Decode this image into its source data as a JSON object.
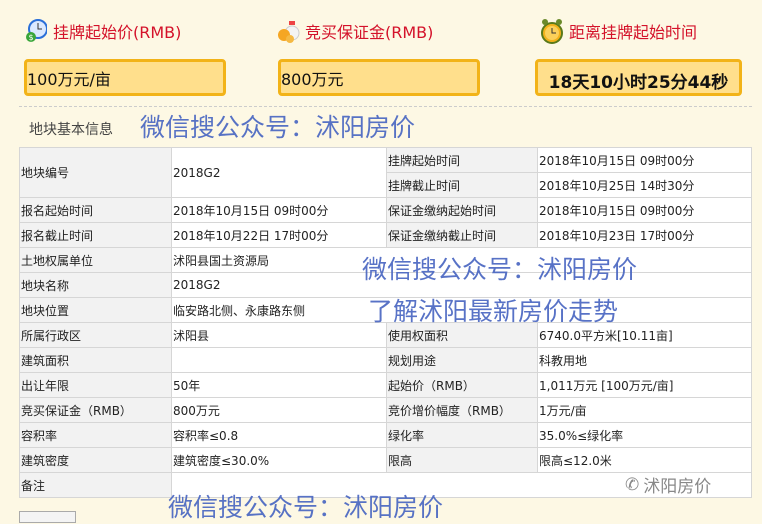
{
  "headers": [
    {
      "label": "挂牌起始价(RMB)",
      "value": "100万元/亩",
      "icon": "clock-money-icon"
    },
    {
      "label": "竞买保证金(RMB)",
      "value": "800万元",
      "icon": "money-bag-icon"
    },
    {
      "label": "距离挂牌起始时间",
      "value": "18天10小时25分44秒",
      "icon": "alarm-clock-icon"
    }
  ],
  "section_title": "地块基本信息",
  "watermarks": {
    "top": "微信搜公众号：沭阳房价",
    "mid1": "微信搜公众号：沭阳房价",
    "mid2": "了解沭阳最新房价走势",
    "bottom": "微信搜公众号：沭阳房价",
    "logo": "沭阳房价"
  },
  "table": {
    "block_no_label": "地块编号",
    "block_no": "2018G2",
    "list_start_label": "挂牌起始时间",
    "list_start": "2018年10月15日 09时00分",
    "list_end_label": "挂牌截止时间",
    "list_end": "2018年10月25日 14时30分",
    "rows": [
      [
        "报名起始时间",
        "2018年10月15日 09时00分",
        "保证金缴纳起始时间",
        "2018年10月15日 09时00分"
      ],
      [
        "报名截止时间",
        "2018年10月22日 17时00分",
        "保证金缴纳截止时间",
        "2018年10月23日 17时00分"
      ],
      [
        "土地权属单位",
        "沭阳县国土资源局"
      ],
      [
        "地块名称",
        "2018G2"
      ],
      [
        "地块位置",
        "临安路北侧、永康路东侧"
      ],
      [
        "所属行政区",
        "沭阳县",
        "使用权面积",
        "6740.0平方米[10.11亩]"
      ],
      [
        "建筑面积",
        "",
        "规划用途",
        "科教用地"
      ],
      [
        "出让年限",
        "50年",
        "起始价（RMB）",
        "1,011万元 [100万元/亩]"
      ],
      [
        "竞买保证金（RMB）",
        "800万元",
        "竞价增价幅度（RMB）",
        "1万元/亩"
      ],
      [
        "容积率",
        "容积率≤0.8",
        "绿化率",
        "35.0%≤绿化率"
      ],
      [
        "建筑密度",
        "建筑密度≤30.0%",
        "限高",
        "限高≤12.0米"
      ],
      [
        "备注",
        ""
      ]
    ]
  }
}
